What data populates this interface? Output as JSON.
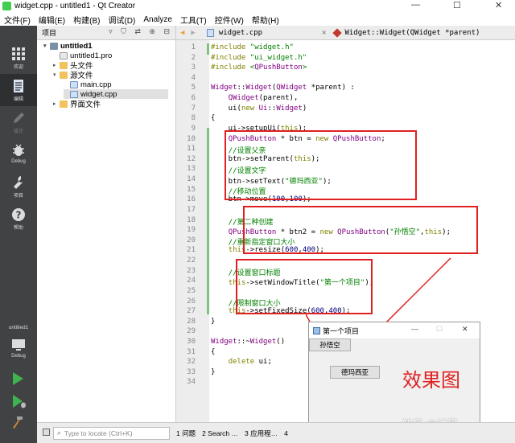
{
  "window": {
    "title": "widget.cpp - untitled1 - Qt Creator",
    "controls": [
      "—",
      "☐",
      "✕"
    ]
  },
  "menu": [
    "文件(F)",
    "编辑(E)",
    "构建(B)",
    "调试(D)",
    "Analyze",
    "工具(T)",
    "控件(W)",
    "帮助(H)"
  ],
  "modes": {
    "welcome": "欢迎",
    "edit": "编辑",
    "design": "设计",
    "debug": "Debug",
    "projects": "项目",
    "help": "帮助",
    "kit_project": "untitled1",
    "kit_mode": "Debug"
  },
  "sidebar": {
    "header": "项目",
    "tree": [
      {
        "label": "untitled1",
        "level": 0,
        "arrow": "▾",
        "icon": "folder-project"
      },
      {
        "label": "untitled1.pro",
        "level": 1,
        "arrow": "",
        "icon": "pro-file"
      },
      {
        "label": "头文件",
        "level": 1,
        "arrow": "▸",
        "icon": "folder"
      },
      {
        "label": "源文件",
        "level": 1,
        "arrow": "▾",
        "icon": "folder"
      },
      {
        "label": "main.cpp",
        "level": 2,
        "arrow": "",
        "icon": "cpp-file"
      },
      {
        "label": "widget.cpp",
        "level": 2,
        "arrow": "",
        "icon": "cpp-file"
      },
      {
        "label": "界面文件",
        "level": 1,
        "arrow": "▸",
        "icon": "folder"
      }
    ]
  },
  "editor": {
    "tab": "widget.cpp",
    "symbol": "Widget::Widget(QWidget *parent)",
    "line_numbers": [
      "1",
      "2",
      "3",
      "4",
      "5",
      "6",
      "7",
      "8",
      "9",
      "10",
      "11",
      "12",
      "13",
      "14",
      "15",
      "16",
      "17",
      "18",
      "19",
      "20",
      "21",
      "22",
      "23",
      "24",
      "25",
      "26",
      "27",
      "28",
      "29",
      "30",
      "31",
      "32",
      "33",
      "34"
    ],
    "lines": [
      "#include \"widget.h\"",
      "#include \"ui_widget.h\"",
      "#include <QPushButton>",
      "",
      "Widget::Widget(QWidget *parent) :",
      "    QWidget(parent),",
      "    ui(new Ui::Widget)",
      "{",
      "    ui->setupUi(this);",
      "    QPushButton * btn = new QPushButton;",
      "    //设置父亲",
      "    btn->setParent(this);",
      "    //设置文字",
      "    btn->setText(\"德玛西亚\");",
      "    //移动位置",
      "    btn->move(100,100);",
      "",
      "    //第二种创建",
      "    QPushButton * btn2 = new QPushButton(\"孙悟空\",this);",
      "    //重新指定窗口大小",
      "    this->resize(600,400);",
      "",
      "    //设置窗口标题",
      "    this->setWindowTitle(\"第一个项目\");",
      "",
      "    //限制窗口大小",
      "    this->setFixedSize(600,400);",
      "}",
      "",
      "Widget::~Widget()",
      "{",
      "    delete ui;",
      "}",
      ""
    ]
  },
  "result_window": {
    "title": "第一个项目",
    "btn2_label": "孙悟空",
    "btn_label": "德玛西亚"
  },
  "annotation": {
    "label": "效果图",
    "watermark": "知乎 @涛哥"
  },
  "bottom": {
    "locator_placeholder": "Type to locate (Ctrl+K)",
    "panes": [
      "1 问题",
      "2 Search …",
      "3 应用程…",
      "4"
    ]
  },
  "colors": {
    "accent_red": "#e02020",
    "mode_bar": "#404244",
    "keyword": "#808000",
    "type": "#800080",
    "string": "#008000"
  }
}
